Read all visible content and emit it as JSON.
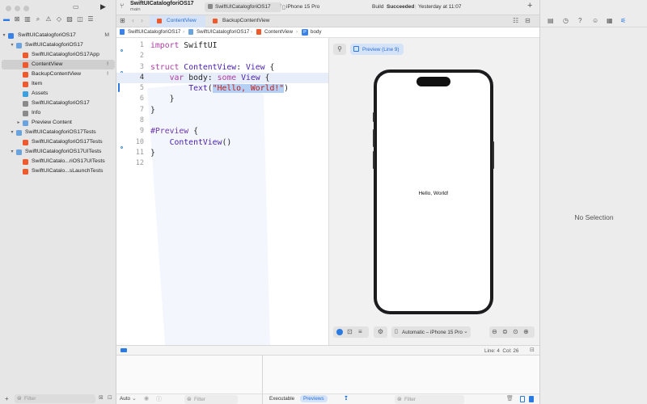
{
  "project": {
    "name": "SwiftUICatalogforiOS17",
    "branch": "main"
  },
  "toolbar": {
    "scheme": "SwiftUICatalogforiOS17",
    "destination": "iPhone 15 Pro",
    "build_status_prefix": "Build",
    "build_status_bold": "Succeeded",
    "build_status_time": "Yesterday at 11:07",
    "add_label": "+"
  },
  "sidebar": {
    "filter_placeholder": "Filter",
    "items": [
      {
        "label": "SwiftUICatalogforiOS17",
        "badge": "M"
      },
      {
        "label": "SwiftUICatalogforiOS17",
        "badge": ""
      },
      {
        "label": "SwiftUICatalogforiOS17App",
        "badge": ""
      },
      {
        "label": "ContentView",
        "badge": "!"
      },
      {
        "label": "BackupContentView",
        "badge": "!"
      },
      {
        "label": "Item",
        "badge": ""
      },
      {
        "label": "Assets",
        "badge": ""
      },
      {
        "label": "SwiftUICatalogforiOS17",
        "badge": ""
      },
      {
        "label": "Info",
        "badge": ""
      },
      {
        "label": "Preview Content",
        "badge": ""
      },
      {
        "label": "SwiftUICatalogforiOS17Tests",
        "badge": ""
      },
      {
        "label": "SwiftUICatalogforiOS17Tests",
        "badge": ""
      },
      {
        "label": "SwiftUICatalogforiOS17UITests",
        "badge": ""
      },
      {
        "label": "SwiftUICatalo...riOS17UITests",
        "badge": ""
      },
      {
        "label": "SwiftUICatalo...sLaunchTests",
        "badge": ""
      }
    ]
  },
  "tabs": [
    {
      "label": "ContentView"
    },
    {
      "label": "BackupContentView"
    }
  ],
  "jump_bar": {
    "items": [
      "SwiftUICatalogforiOS17",
      "SwiftUICatalogforiOS17",
      "ContentView",
      "body"
    ]
  },
  "editor": {
    "line_numbers": [
      "1",
      "2",
      "3",
      "4",
      "5",
      "6",
      "7",
      "8",
      "9",
      "10",
      "11",
      "12"
    ]
  },
  "preview": {
    "label": "Preview (Line 9)",
    "hello_text": "Hello, World!",
    "device_menu": "Automatic – iPhone 15 Pro"
  },
  "status": {
    "position": "Line: 4  Col: 26"
  },
  "debug": {
    "auto_label": "Auto",
    "filter_placeholder": "Filter",
    "executable_tab": "Executable",
    "previews_tab": "Previews"
  },
  "inspector": {
    "empty_text": "No Selection"
  },
  "colors": {
    "accent": "#2a7ae2",
    "keyword": "#ad3da4",
    "type": "#4b21b0",
    "string": "#c41a16"
  }
}
